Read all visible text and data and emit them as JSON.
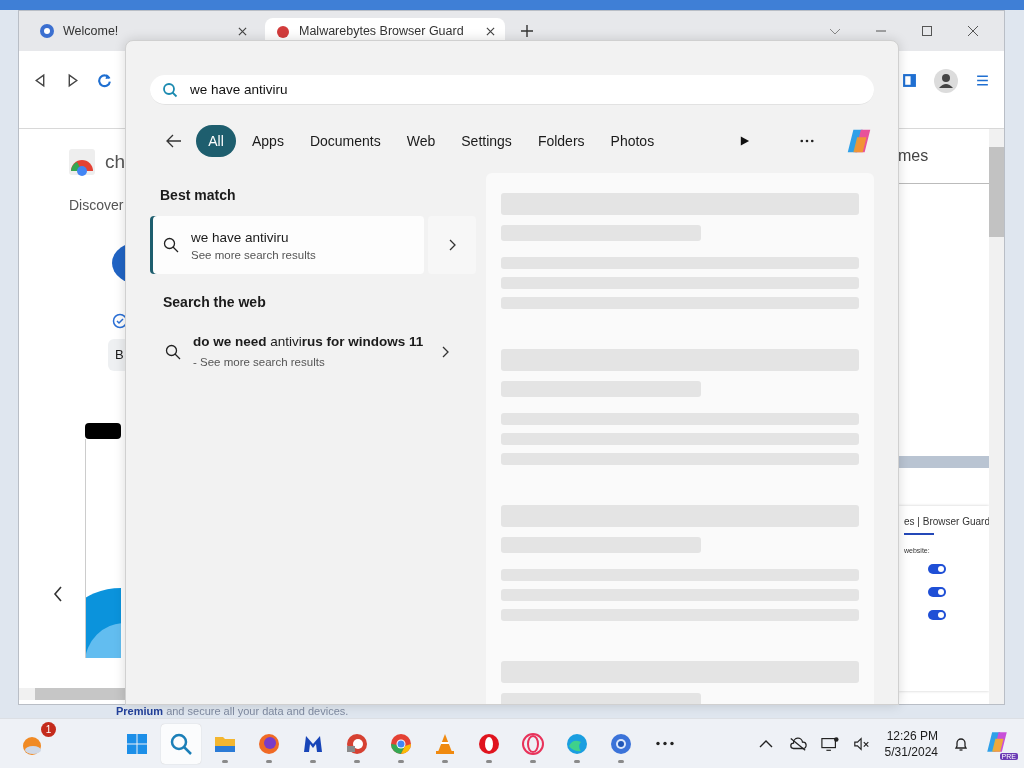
{
  "browser": {
    "tabs": [
      {
        "title": "Welcome!",
        "selected": false
      },
      {
        "title": "Malwarebytes Browser Guard",
        "selected": true
      }
    ],
    "page_left": {
      "heading": "ch",
      "subheading": "Discover",
      "button": "B"
    },
    "page_right": {
      "heading": "mes",
      "panel_title": "es | Browser Guard",
      "panel_label": "website:",
      "toggles": [
        {
          "on": true
        },
        {
          "on": true
        },
        {
          "on": true
        }
      ]
    },
    "footer_text": "**Premium** and secure all your data and devices."
  },
  "search": {
    "query": "we have antiviru",
    "filters": [
      {
        "label": "All",
        "selected": true
      },
      {
        "label": "Apps",
        "selected": false
      },
      {
        "label": "Documents",
        "selected": false
      },
      {
        "label": "Web",
        "selected": false
      },
      {
        "label": "Settings",
        "selected": false
      },
      {
        "label": "Folders",
        "selected": false
      },
      {
        "label": "Photos",
        "selected": false
      }
    ],
    "best_match": {
      "heading": "Best match",
      "title": "we have antiviru",
      "subtitle": "See more search results",
      "selected": true
    },
    "web": {
      "heading": "Search the web",
      "results": [
        {
          "title": "**do we need** antivi**rus for windows 11**",
          "subtitle": "- See more search results"
        }
      ]
    },
    "preview": {
      "loading": true
    }
  },
  "taskbar": {
    "weather_badge": "1",
    "apps": [
      {
        "kind": "start",
        "selected": false,
        "running": false
      },
      {
        "kind": "search",
        "selected": true,
        "running": false
      },
      {
        "kind": "folder",
        "selected": false,
        "running": true
      },
      {
        "kind": "firefox",
        "selected": false,
        "running": true
      },
      {
        "kind": "malwarebytes",
        "selected": false,
        "running": true
      },
      {
        "kind": "ccleaner",
        "selected": false,
        "running": true
      },
      {
        "kind": "chrome",
        "selected": false,
        "running": true
      },
      {
        "kind": "vlc",
        "selected": false,
        "running": true
      },
      {
        "kind": "opera",
        "selected": false,
        "running": true
      },
      {
        "kind": "operagx",
        "selected": false,
        "running": true
      },
      {
        "kind": "edge",
        "selected": false,
        "running": true
      },
      {
        "kind": "chromium",
        "selected": false,
        "running": true
      },
      {
        "kind": "more",
        "selected": false,
        "running": false
      }
    ],
    "time": "12:26 PM",
    "date": "5/31/2024",
    "copilot_badge": "PRE"
  }
}
